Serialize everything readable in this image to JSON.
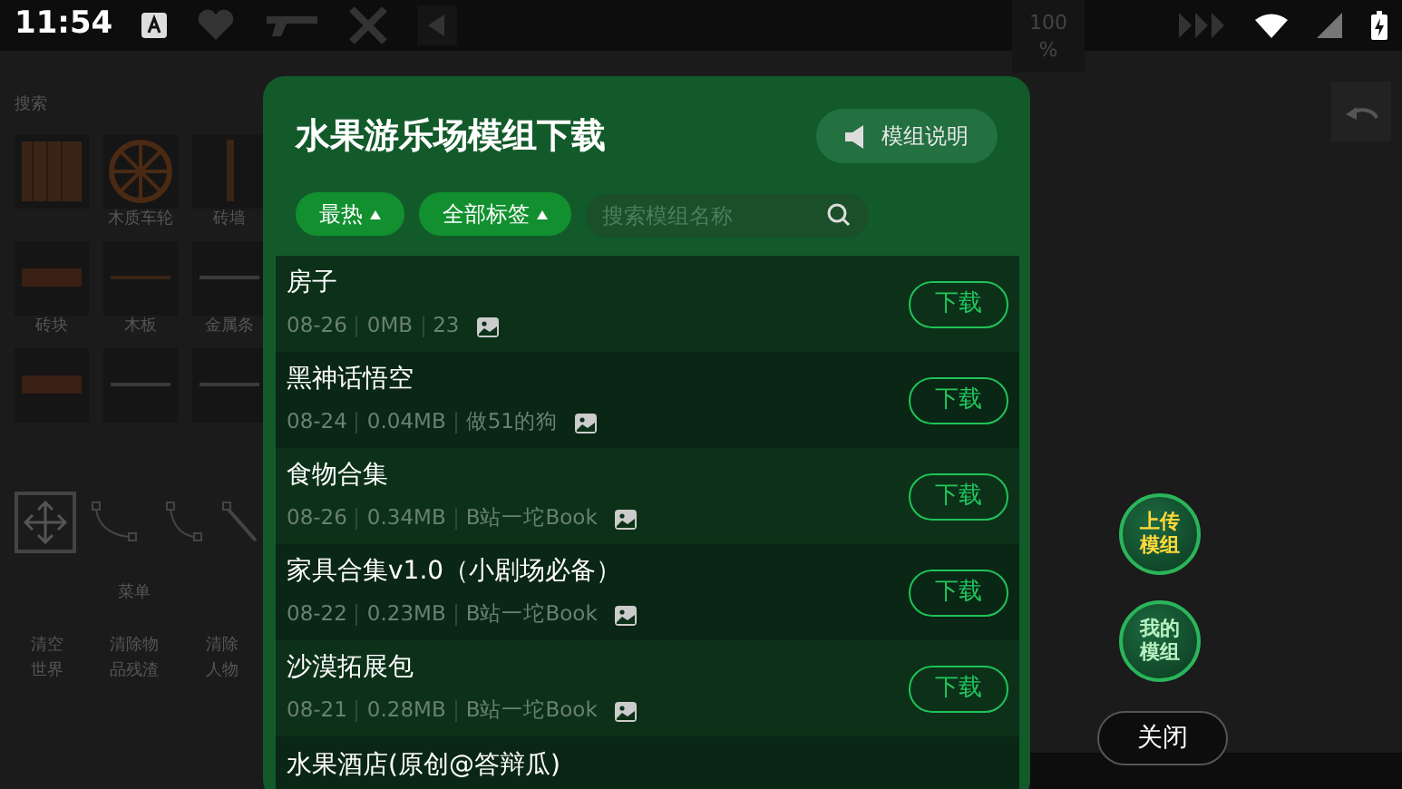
{
  "status_bar": {
    "time": "11:54"
  },
  "game": {
    "search_label": "搜索",
    "zoom_value": "100",
    "zoom_unit": "%",
    "items": [
      {
        "kind": "crate"
      },
      {
        "kind": "wheel",
        "label": "木质车轮"
      },
      {
        "kind": "wall",
        "label": "砖墙"
      },
      {
        "kind": "brick",
        "label": "砖块"
      },
      {
        "kind": "plank",
        "label": "木板"
      },
      {
        "kind": "bar",
        "label": "金属条"
      },
      {
        "kind": "brick"
      },
      {
        "kind": "bar"
      },
      {
        "kind": "bar"
      }
    ],
    "menu_label": "菜单",
    "actions": [
      "清空世界",
      "清除物品残渣",
      "清除人物"
    ]
  },
  "dialog": {
    "title": "水果游乐场模组下载",
    "help_button": "模组说明",
    "filters": [
      {
        "label": "最热"
      },
      {
        "label": "全部标签"
      }
    ],
    "search": {
      "placeholder": "搜索模组名称"
    },
    "mods": [
      {
        "name": "房子",
        "date": "08-26",
        "size": "0MB",
        "author": "23",
        "action": "下载"
      },
      {
        "name": "黑神话悟空",
        "date": "08-24",
        "size": "0.04MB",
        "author": "做51的狗",
        "action": "下载"
      },
      {
        "name": "食物合集",
        "date": "08-26",
        "size": "0.34MB",
        "author": "B站一坨Book",
        "action": "下载"
      },
      {
        "name": "家具合集v1.0（小剧场必备）",
        "date": "08-22",
        "size": "0.23MB",
        "author": "B站一坨Book",
        "action": "下载"
      },
      {
        "name": "沙漠拓展包",
        "date": "08-21",
        "size": "0.28MB",
        "author": "B站一坨Book",
        "action": "下载"
      },
      {
        "name": "水果酒店(原创@答辩瓜)"
      }
    ]
  },
  "side_buttons": [
    {
      "kind": "upload",
      "label": "上传模组"
    },
    {
      "kind": "mine",
      "label": "我的模组"
    }
  ],
  "close_button": "关闭"
}
